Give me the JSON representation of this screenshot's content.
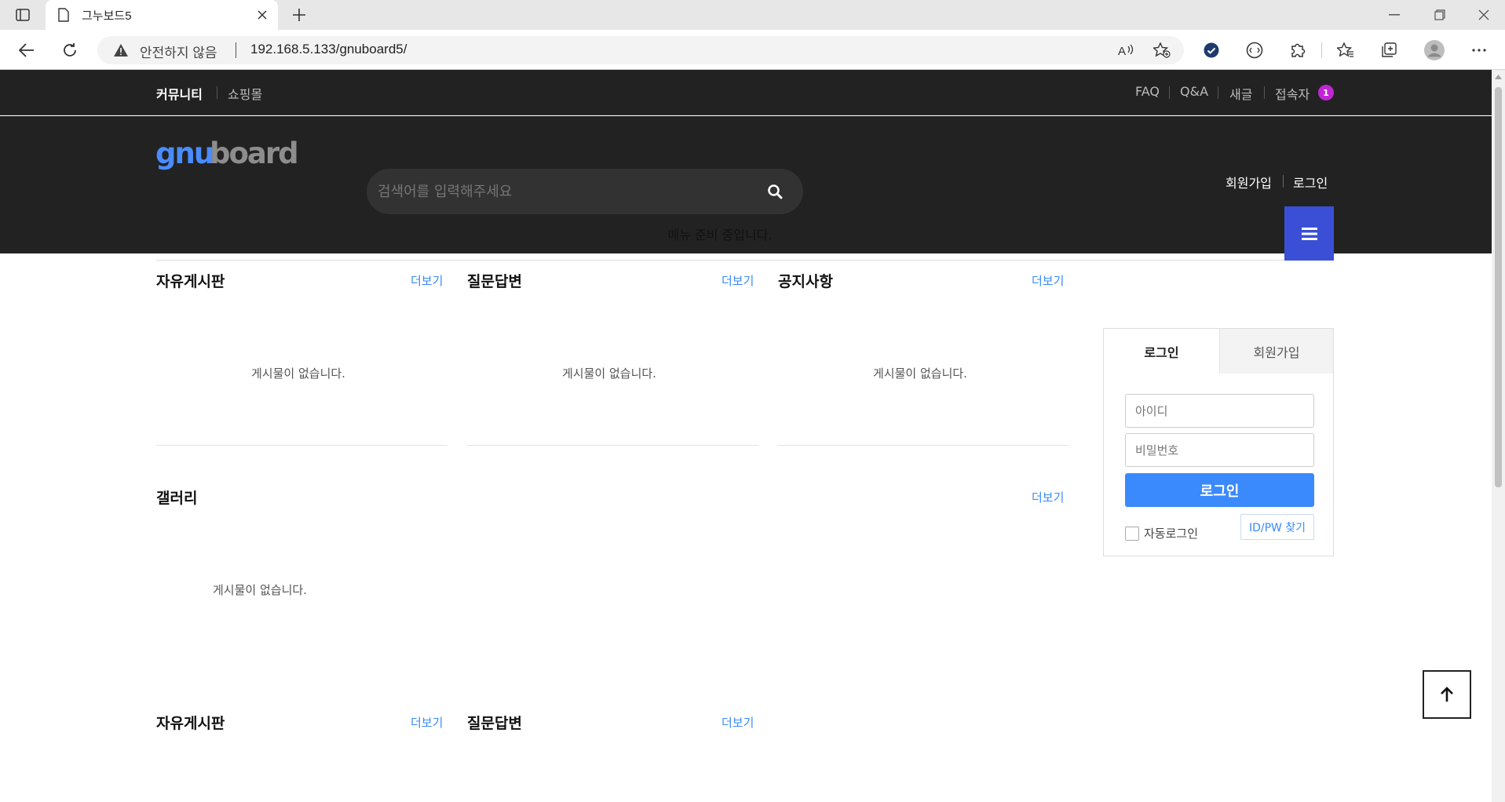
{
  "browser": {
    "tab_title": "그누보드5",
    "security_label": "안전하지 않음",
    "url": "192.168.5.133/gnuboard5/"
  },
  "topbar": {
    "left": [
      "커뮤니티",
      "쇼핑몰"
    ],
    "right": [
      "FAQ",
      "Q&A",
      "새글",
      "접속자"
    ],
    "visitors_count": "1"
  },
  "header": {
    "logo": "gnuboard",
    "search_placeholder": "검색어를 입력해주세요",
    "join": "회원가입",
    "login": "로그인"
  },
  "nav": {
    "message": "메뉴 준비 중입니다."
  },
  "latest": {
    "more_label": "더보기",
    "empty_text": "게시물이 없습니다.",
    "row1": [
      "자유게시판",
      "질문답변",
      "공지사항"
    ],
    "gallery": "갤러리",
    "row3": [
      "자유게시판",
      "질문답변"
    ]
  },
  "login_box": {
    "tab_login": "로그인",
    "tab_join": "회원가입",
    "id_placeholder": "아이디",
    "pw_placeholder": "비밀번호",
    "submit": "로그인",
    "auto_login": "자동로그인",
    "find": "ID/PW 찾기"
  },
  "colors": {
    "header_bg": "#222222",
    "accent_blue": "#3a8afd",
    "nav_button": "#3a4fd6",
    "badge": "#c026d3"
  }
}
